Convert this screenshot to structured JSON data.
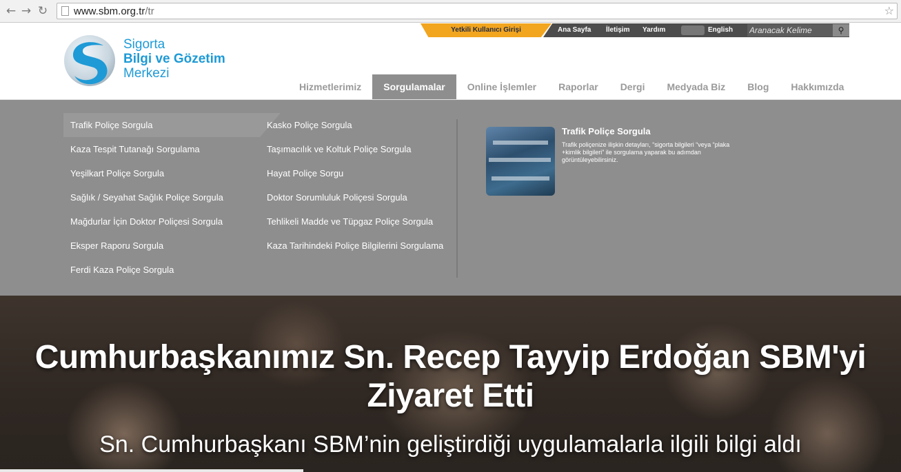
{
  "browser": {
    "url_host": "www.sbm.org.tr",
    "url_path": "/tr"
  },
  "logo": {
    "line1": "Sigorta",
    "line2": "Bilgi ve Gözetim",
    "line3": "Merkezi",
    "color": "#1e9ad6"
  },
  "topbar": {
    "login": "Yetkili Kullanıcı Girişi",
    "links": [
      "Ana Sayfa",
      "İletişim",
      "Yardım"
    ],
    "language": "English",
    "search_placeholder": "Aranacak Kelime"
  },
  "mainnav": {
    "items": [
      "Hizmetlerimiz",
      "Sorgulamalar",
      "Online İşlemler",
      "Raporlar",
      "Dergi",
      "Medyada Biz",
      "Blog",
      "Hakkımızda"
    ],
    "active_index": 1
  },
  "menu": {
    "col1": [
      "Trafik Poliçe Sorgula",
      "Kaza Tespit Tutanağı Sorgulama",
      "Yeşilkart Poliçe Sorgula",
      "Sağlık / Seyahat Sağlık Poliçe Sorgula",
      "Mağdurlar İçin Doktor Poliçesi Sorgula",
      "Eksper Raporu Sorgula",
      "Ferdi Kaza Poliçe Sorgula"
    ],
    "col2": [
      "Kasko Poliçe Sorgula",
      "Taşımacılık ve Koltuk Poliçe Sorgula",
      "Hayat Poliçe Sorgu",
      "Doktor Sorumluluk Poliçesi Sorgula",
      "Tehlikeli Madde ve Tüpgaz Poliçe Sorgula",
      "Kaza Tarihindeki Poliçe Bilgilerini Sorgulama"
    ],
    "feature": {
      "title": "Trafik Poliçe Sorgula",
      "description": "Trafik poliçenize ilişkin detayları, “sigorta bilgileri “veya “plaka +kimlik bilgileri” ile sorgulama yaparak bu adımdan görüntüleyebilirsiniz."
    }
  },
  "hero": {
    "title": "Cumhurbaşkanımız Sn. Recep Tayyip Erdoğan SBM'yi Ziyaret Etti",
    "subtitle": "Sn. Cumhurbaşkanı SBM’nin geliştirdiği uygulamalarla ilgili bilgi aldı"
  },
  "colors": {
    "accent_orange": "#f2a51f",
    "menu_gray": "#8e8e8e",
    "topbar_dark": "#4c4c4c"
  }
}
